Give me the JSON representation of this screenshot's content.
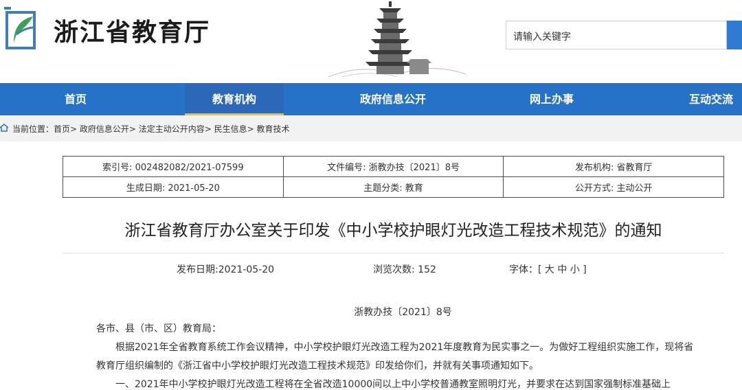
{
  "header": {
    "site_title": "浙江省教育厅",
    "search_placeholder": "请输入关键字"
  },
  "nav": {
    "items": [
      "首页",
      "教育机构",
      "政府信息公开",
      "网上办事",
      "互动交流"
    ],
    "active": "教育机构"
  },
  "breadcrumb": {
    "text": "当前位置：首页> 政府信息公开> 法定主动公开内容> 民生信息> 教育技术"
  },
  "meta": {
    "index_no": "索引号: 002482082/2021-07599",
    "doc_no": "文件编号: 浙教办技〔2021〕8号",
    "publisher": "发布机构: 省教育厅",
    "created": "生成日期: 2021-05-20",
    "topic": "主题分类: 教育",
    "disclosure": "公开方式: 主动公开"
  },
  "article": {
    "title": "浙江省教育厅办公室关于印发《中小学校护眼灯光改造工程技术规范》的通知",
    "publish_date": "发布日期:2021-05-20",
    "views": "浏览次数: 152",
    "font_size": "字体：[ 大 中 小 ]",
    "doc_number": "浙教办技〔2021〕8号",
    "salutation": "各市、县（市、区）教育局：",
    "para1": "根据2021年全省教育系统工作会议精神，中小学校护眼灯光改造工程为2021年度教育为民实事之一。为做好工程组织实施工作，现将省教育厅组织编制的《浙江省中小学校护眼灯光改造工程技术规范》印发给你们，并就有关事项通知如下。",
    "para2": "一、2021年中小学校护眼灯光改造工程将在全省改造10000间以上中小学校普通教室照明灯光，并要求在达到国家强制标准基础上"
  },
  "colors": {
    "nav_bg": "#2572c8",
    "nav_active_underline": "#f2b631",
    "search_button": "#2f7bd2"
  }
}
